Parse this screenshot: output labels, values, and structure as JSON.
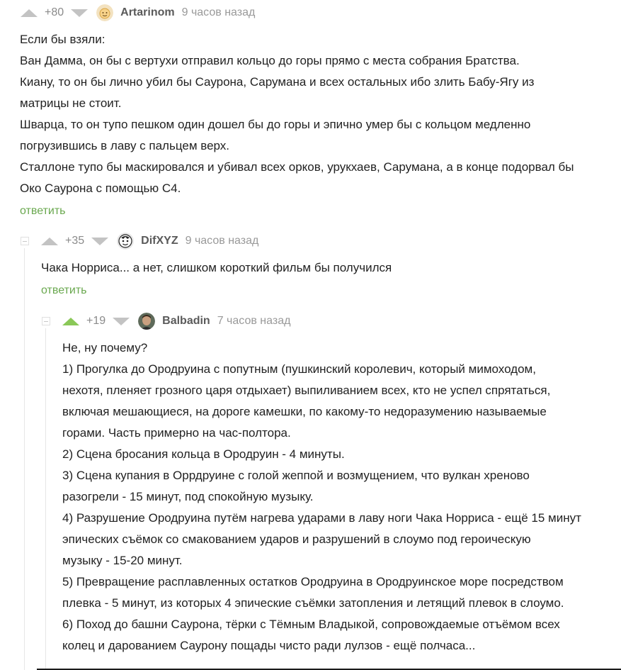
{
  "comments": [
    {
      "rating": "+80",
      "author": "Artarinom",
      "time": "9 часов назад",
      "lines": [
        "Если бы взяли:",
        "Ван Дамма, он бы с вертухи отправил кольцо до горы прямо с места собрания Братства.",
        "Киану, то он бы лично убил бы Саурона, Сарумана и всех остальных ибо злить Бабу-Ягу из",
        "матрицы не стоит.",
        "Шварца, то он тупо пешком один дошел бы до горы и эпично умер бы с кольцом медленно",
        "погрузившись в лаву с пальцем верх.",
        "Сталлоне тупо бы маскировался и убивал всех орков, урукхаев, Сарумана, а в конце подорвал бы",
        "Око Саурона с помощью С4."
      ],
      "reply": "ответить"
    },
    {
      "rating": "+35",
      "author": "DifXYZ",
      "time": "9 часов назад",
      "lines": [
        "Чака Норриса... а нет, слишком короткий фильм бы получился"
      ],
      "reply": "ответить"
    },
    {
      "rating": "+19",
      "author": "Balbadin",
      "time": "7 часов назад",
      "lines": [
        "Не, ну почему?",
        "1) Прогулка до Ородруина с попутным (пушкинский королевич, который мимоходом,",
        "нехотя, пленяет грозного царя отдыхает) выпиливанием всех, кто не успел спрятаться,",
        "включая мешающиеся, на дороге камешки, по какому-то недоразумению называемые",
        "горами. Часть примерно на час-полтора.",
        "2) Сцена бросания кольца в Ородруин - 4 минуты.",
        "3) Сцена купания в Оррдруине с голой жеппой и возмущением, что вулкан хреново",
        "разогрели - 15 минут, под спокойную музыку.",
        "4) Разрушение Ородруина путём нагрева ударами в лаву ноги Чака Норриса - ещё 15 минут",
        "эпических съёмок со смакованием ударов и разрушений в слоумо под героическую",
        "музыку - 15-20 минут.",
        "5) Превращение расплавленных остатков Ородруина в Ородруинское море посредством",
        "плевка - 5 минут, из которых 4 эпические съёмки затопления и летящий плевок в слоумо.",
        "6) Поход до башни Саурона, тёрки с Тёмным Владыкой, сопровождаемые отъёмом всех",
        "колец и дарованием Саурону пощады чисто ради лулзов - ещё полчаса..."
      ]
    }
  ]
}
